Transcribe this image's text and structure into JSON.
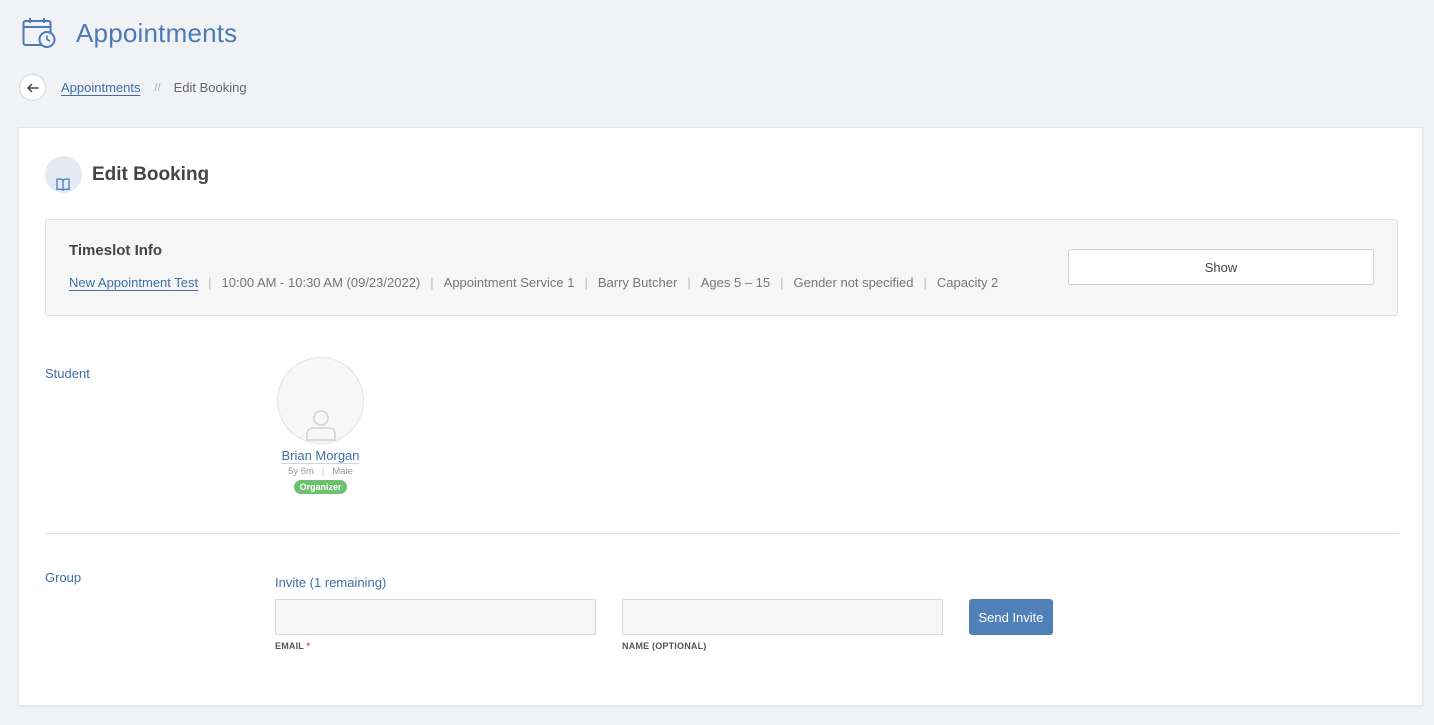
{
  "page": {
    "title": "Appointments",
    "icon": "calendar-clock-icon"
  },
  "breadcrumb": {
    "back_icon": "arrow-left-icon",
    "parent": "Appointments",
    "separator": "//",
    "current": "Edit Booking"
  },
  "card": {
    "title": "Edit Booking",
    "icon": "book-open-icon"
  },
  "timeslot": {
    "title": "Timeslot Info",
    "appointment_name": "New Appointment Test",
    "time": "10:00 AM - 10:30 AM (09/23/2022)",
    "service": "Appointment Service 1",
    "instructor": "Barry Butcher",
    "ages": "Ages 5 – 15",
    "gender": "Gender not specified",
    "capacity": "Capacity 2",
    "show_label": "Show"
  },
  "student": {
    "label": "Student",
    "avatar_icon": "user-placeholder-icon",
    "name": "Brian Morgan",
    "age": "5y 6m",
    "gender": "Male",
    "badge": "Organizer"
  },
  "group": {
    "label": "Group",
    "invite_title": "Invite (1 remaining)",
    "email_value": "",
    "email_label": "EMAIL",
    "email_required_mark": "*",
    "name_value": "",
    "name_label": "NAME (OPTIONAL)",
    "send_label": "Send Invite"
  },
  "colors": {
    "accent": "#4a7bb7",
    "link": "#3f6fa8",
    "badge_green": "#6cc070",
    "primary_button": "#4f81b8",
    "background": "#f0f2f6"
  }
}
